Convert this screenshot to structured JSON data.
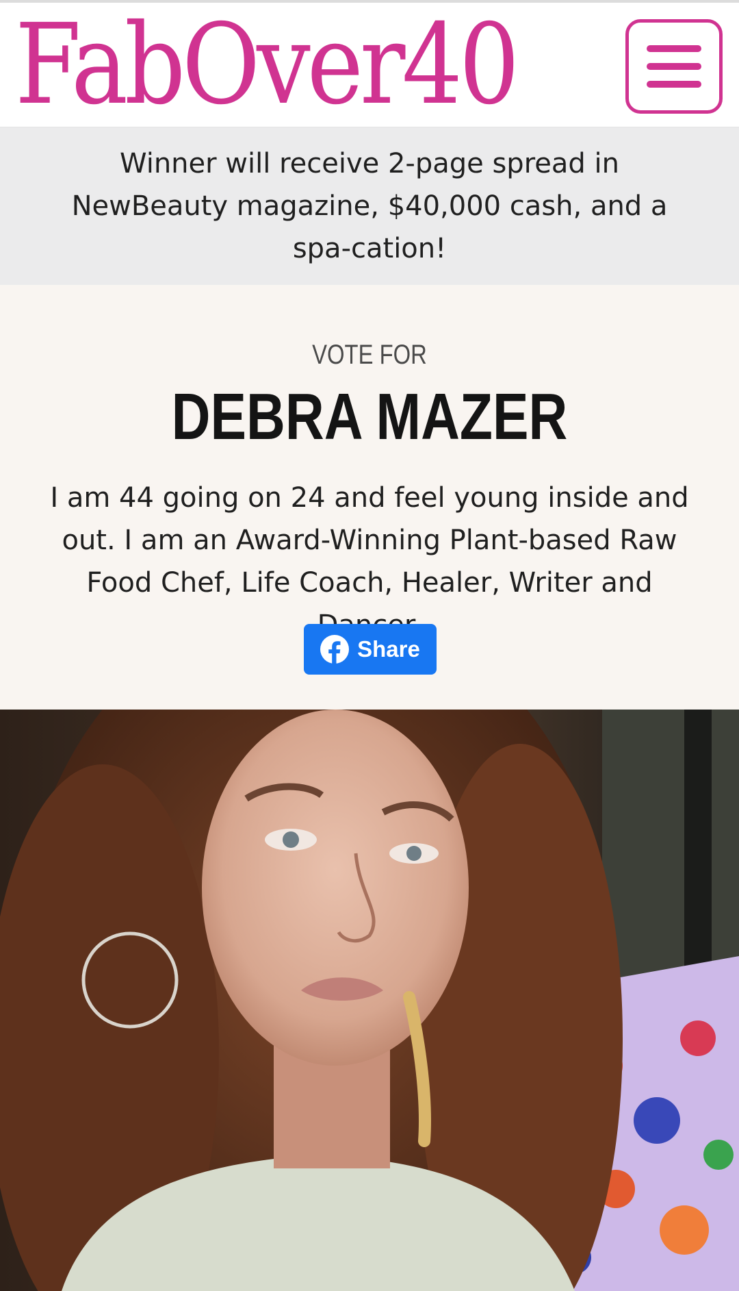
{
  "header": {
    "logo_text": "FabOver40",
    "menu_icon": "hamburger-menu-icon"
  },
  "banner": {
    "text": "Winner will receive 2-page spread in NewBeauty magazine, $40,000 cash, and a spa-cation!"
  },
  "contestant": {
    "vote_label": "VOTE FOR",
    "name": "DEBRA MAZER",
    "bio": "I am 44 going on 24 and feel young inside and out. I am an Award-Winning Plant-based Raw Food Chef, Life Coach, Healer, Writer and Dancer.",
    "share_label": "Share",
    "share_icon": "facebook-icon",
    "photo_icon": "contestant-photo"
  },
  "colors": {
    "brand_pink": "#d03391",
    "facebook_blue": "#1877f2",
    "banner_bg": "#ebebec",
    "section_bg": "#f9f5f1"
  }
}
